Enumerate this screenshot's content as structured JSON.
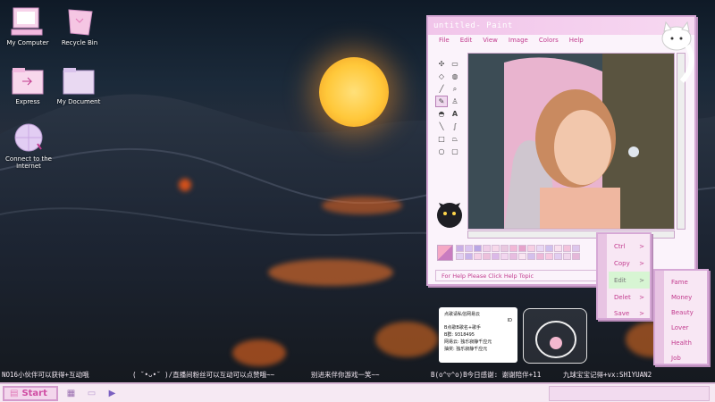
{
  "desktop": {
    "icons": [
      {
        "label": "My Computer"
      },
      {
        "label": "Recycle Bin"
      },
      {
        "label": "Express"
      },
      {
        "label": "My Document"
      },
      {
        "label": "Connect to the Internet"
      }
    ]
  },
  "paint": {
    "title": "untitled- Paint",
    "menu": [
      "File",
      "Edit",
      "View",
      "Image",
      "Colors",
      "Help"
    ],
    "status": "For Help Please Click Help Topic",
    "palette_colors": [
      "#c9b0e6",
      "#d9c3ef",
      "#b9a7e4",
      "#f0cfe8",
      "#f7d9ea",
      "#e9c8df",
      "#f2b8d6",
      "#e6a3cb",
      "#f6cfe3",
      "#e8d8f4",
      "#cfc1ee",
      "#f8e0ee",
      "#f3c3dc",
      "#dcc7ec",
      "#e2d0f2",
      "#c7b4e9",
      "#f5d2e7",
      "#ecc0db",
      "#dbb9e8",
      "#f2d6ef",
      "#e7bde0",
      "#f9e5f1",
      "#d4c0ec",
      "#eeb9d8",
      "#f7c9e1",
      "#e1cdf1",
      "#f0d7ec",
      "#e5b8d9"
    ],
    "accent": "#c23b8e"
  },
  "context_menu_1": {
    "items": [
      {
        "label": "Ctrl",
        "arrow": ">"
      },
      {
        "label": "Copy",
        "arrow": ">"
      },
      {
        "label": "Edit",
        "arrow": ">"
      },
      {
        "label": "Delet",
        "arrow": ">"
      },
      {
        "label": "Save",
        "arrow": ">"
      }
    ]
  },
  "context_menu_2": {
    "items": [
      "Fame",
      "Money",
      "Beauty",
      "Lover",
      "Health",
      "Job"
    ]
  },
  "ticker": {
    "segments": [
      "NO16小伙伴可以获得+互动哦",
      "( ˘•ᴗ•˘ )/直播间粉丝可以互动可以点赞哦~~",
      "别进来伴你游戏一笑~~",
      "B(o^▽^o)B今日感谢: 谢谢陪伴+11",
      "九球宝宝记得+vx:SH1YUAN2"
    ]
  },
  "card": {
    "lines": [
      "点歌请私信网易云",
      "ID",
      "B点歌B歌名+歌手",
      "B群: 9318495",
      "网易云: 独乐寂静千应元",
      "抽奖: 独乐寂静千应元"
    ]
  },
  "taskbar": {
    "start_label": "Start"
  }
}
